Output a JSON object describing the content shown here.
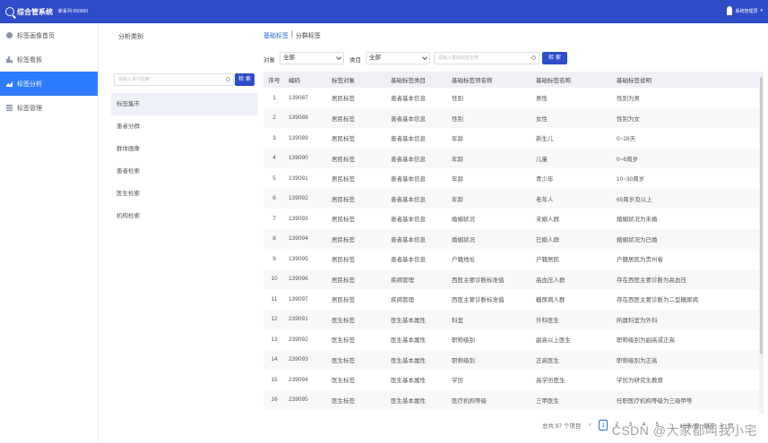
{
  "header": {
    "app_title": "综合管系统",
    "app_sub": "新系列 000000",
    "user_name": "系统管理员"
  },
  "sidebar": {
    "items": [
      {
        "label": "标签画像首页",
        "icon": "eye-icon",
        "active": false
      },
      {
        "label": "标签看板",
        "icon": "bar-chart-icon",
        "active": false
      },
      {
        "label": "标签分析",
        "icon": "line-chart-icon",
        "active": true
      },
      {
        "label": "标签管理",
        "icon": "list-icon",
        "active": false
      }
    ]
  },
  "category_panel": {
    "title": "分析类别",
    "search_placeholder": "请输入进行检索",
    "search_button": "检 索",
    "items": [
      "标签集市",
      "患者分群",
      "群体画像",
      "患者检索",
      "医生检索",
      "机构检索"
    ],
    "active_index": 0
  },
  "main": {
    "tabs": [
      {
        "label": "基础标签",
        "active": true
      },
      {
        "label": "|",
        "active": false
      },
      {
        "label": "分群标签",
        "active": false
      }
    ],
    "filters": {
      "object_label": "对象",
      "object_value": "全部",
      "category_label": "类目",
      "category_value": "全部",
      "search_placeholder": "请输入基础标签名称",
      "search_button": "检 索"
    },
    "table": {
      "columns": [
        "序号",
        "编码",
        "标签对象",
        "基础标签类目",
        "基础标签项名称",
        "基础标签名称",
        "基础标签说明"
      ],
      "rows": [
        [
          "1",
          "139087",
          "居民标签",
          "患者基本信息",
          "性别",
          "男性",
          "性别为男"
        ],
        [
          "2",
          "139088",
          "居民标签",
          "患者基本信息",
          "性别",
          "女性",
          "性别为女"
        ],
        [
          "3",
          "139089",
          "居民标签",
          "患者基本信息",
          "年龄",
          "新生儿",
          "0~28天"
        ],
        [
          "4",
          "139090",
          "居民标签",
          "患者基本信息",
          "年龄",
          "儿童",
          "0~6周岁"
        ],
        [
          "5",
          "139091",
          "居民标签",
          "患者基本信息",
          "年龄",
          "青少年",
          "10~30周岁"
        ],
        [
          "6",
          "139092",
          "居民标签",
          "患者基本信息",
          "年龄",
          "老年人",
          "65周岁及以上"
        ],
        [
          "7",
          "139093",
          "居民标签",
          "患者基本信息",
          "婚姻状况",
          "未婚人群",
          "婚姻状况为未婚"
        ],
        [
          "8",
          "139094",
          "居民标签",
          "患者基本信息",
          "婚姻状况",
          "已婚人群",
          "婚姻状况为已婚"
        ],
        [
          "9",
          "139095",
          "居民标签",
          "患者基本信息",
          "户籍地址",
          "户籍居民",
          "户籍居民为贵州省"
        ],
        [
          "10",
          "139096",
          "居民标签",
          "疾病管理",
          "西医主要诊断标准值",
          "高血压人群",
          "存在西医主要诊断为高血压"
        ],
        [
          "11",
          "139097",
          "居民标签",
          "疾病管理",
          "西医主要诊断标准值",
          "糖尿病人群",
          "存在西医主要诊断为二型糖尿病"
        ],
        [
          "12",
          "239091",
          "医生标签",
          "医生基本属性",
          "科室",
          "外科医生",
          "所属科室为外科"
        ],
        [
          "13",
          "239092",
          "医生标签",
          "医生基本属性",
          "职称级别",
          "副高以上医生",
          "职称级别为副高或正高"
        ],
        [
          "14",
          "239093",
          "医生标签",
          "医生基本属性",
          "职称级别",
          "正高医生",
          "职称级别为正高"
        ],
        [
          "15",
          "239094",
          "医生标签",
          "医生基本属性",
          "学历",
          "高学历医生",
          "学历为研究生教育"
        ],
        [
          "16",
          "239095",
          "医生标签",
          "医生基本属性",
          "医疗机构等级",
          "三甲医生",
          "任职医疗机构等级为三级甲等"
        ]
      ]
    },
    "pagination": {
      "total_text": "总共 97 个项目",
      "pages": [
        "1",
        "2",
        "3",
        "4",
        "5"
      ],
      "active_page": "1",
      "page_size": "16条/页",
      "goto_label": "跳至",
      "goto_value": "1",
      "page_unit": "页"
    }
  },
  "watermark": "CSDN @大家都叫我小宅",
  "colors": {
    "topbar": "#2f4cc9",
    "sidebar_active": "#2f7bff",
    "primary_button": "#2f4cc9",
    "tab_active": "#2f6bd8"
  }
}
